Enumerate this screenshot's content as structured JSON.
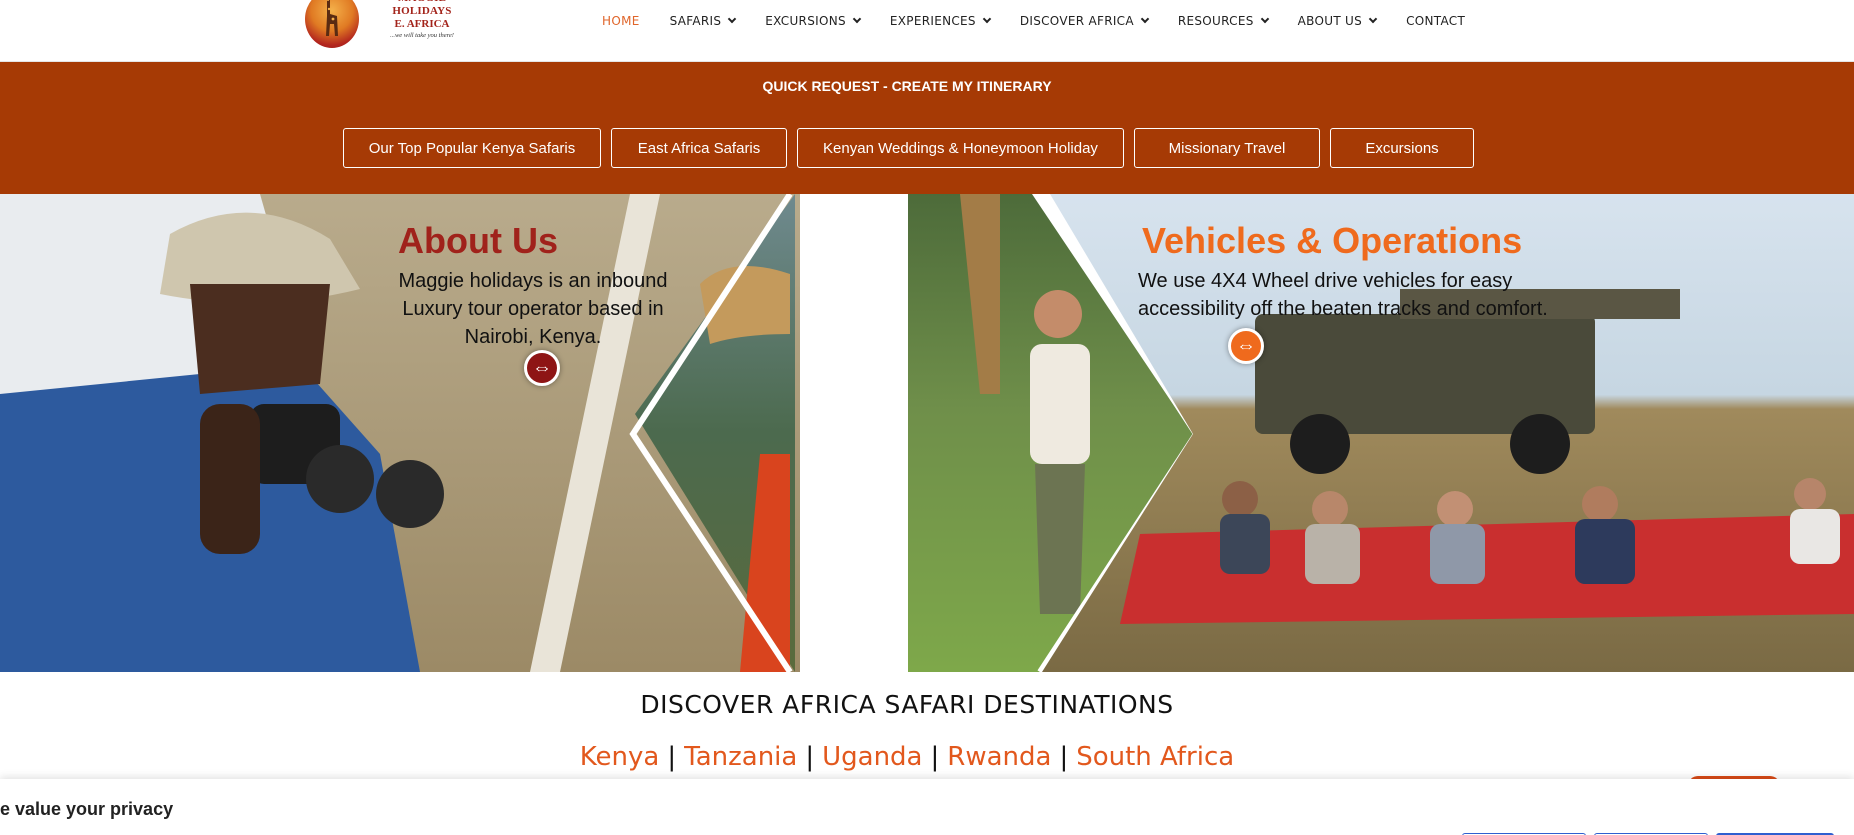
{
  "header": {
    "logo": {
      "line1": "MAGGIE HOLIDAYS",
      "line2": "E. AFRICA",
      "tagline": "...we will take you there!"
    },
    "nav": [
      {
        "label": "HOME",
        "active": true,
        "dropdown": false
      },
      {
        "label": "SAFARIS",
        "active": false,
        "dropdown": true
      },
      {
        "label": "EXCURSIONS",
        "active": false,
        "dropdown": true
      },
      {
        "label": "EXPERIENCES",
        "active": false,
        "dropdown": true
      },
      {
        "label": "DISCOVER AFRICA",
        "active": false,
        "dropdown": true
      },
      {
        "label": "RESOURCES",
        "active": false,
        "dropdown": true
      },
      {
        "label": "ABOUT US",
        "active": false,
        "dropdown": true
      },
      {
        "label": "CONTACT",
        "active": false,
        "dropdown": false
      }
    ]
  },
  "quick_request": {
    "link_label": "QUICK REQUEST - CREATE MY ITINERARY",
    "buttons": [
      "Our Top Popular Kenya Safaris",
      "East Africa Safaris",
      "Kenyan Weddings & Honeymoon Holiday",
      "Missionary Travel",
      "Excursions"
    ]
  },
  "banner": {
    "about": {
      "title": "About Us",
      "text_lines": [
        "Maggie holidays is an inbound",
        "Luxury tour operator based in",
        "Nairobi, Kenya."
      ]
    },
    "vehicles": {
      "title": "Vehicles & Operations",
      "text_lines": [
        "We use 4X4 Wheel drive vehicles for easy",
        "accessibility off the beaten tracks and comfort."
      ]
    },
    "arrow_icon": "⇔"
  },
  "destinations": {
    "title": "DISCOVER AFRICA SAFARI DESTINATIONS",
    "links": [
      "Kenya",
      "Tanzania",
      "Uganda",
      "Rwanda",
      "South Africa"
    ],
    "separator": "|"
  },
  "privacy": {
    "title": "e value your privacy"
  },
  "colors": {
    "band": "#a63a05",
    "accent": "#e2581d",
    "about_title": "#a0221b",
    "vehicles_title": "#ef6a1d",
    "privacy_button": "#2f5fd0"
  }
}
